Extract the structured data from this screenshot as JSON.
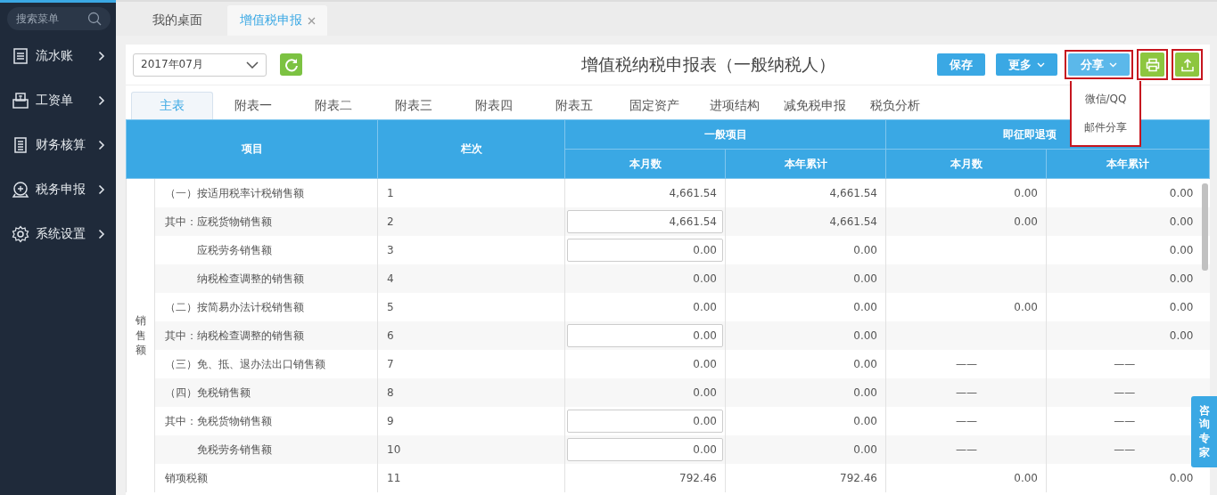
{
  "sidebar": {
    "search": {
      "placeholder": "搜索菜单"
    },
    "items": [
      {
        "label": "流水账"
      },
      {
        "label": "工资单"
      },
      {
        "label": "财务核算"
      },
      {
        "label": "税务申报"
      },
      {
        "label": "系统设置"
      }
    ]
  },
  "page_tabs": [
    {
      "label": "我的桌面",
      "selected": false,
      "closable": false
    },
    {
      "label": "增值税申报",
      "selected": true,
      "closable": true
    }
  ],
  "toolbar": {
    "period": "2017年07月",
    "title": "增值税纳税申报表（一般纳税人）",
    "buttons": [
      {
        "label": "保存",
        "kind": "plain",
        "highlighted": false
      },
      {
        "label": "更多",
        "kind": "menu",
        "highlighted": false
      },
      {
        "label": "分享",
        "kind": "menu",
        "highlighted": true
      }
    ],
    "icon_buttons": [
      {
        "kind": "print",
        "highlighted": true
      },
      {
        "kind": "export",
        "highlighted": true
      }
    ],
    "share_menu": [
      "微信/QQ",
      "邮件分享"
    ]
  },
  "sheet_tabs": [
    {
      "label": "主表",
      "selected": true
    },
    {
      "label": "附表一",
      "selected": false
    },
    {
      "label": "附表二",
      "selected": false
    },
    {
      "label": "附表三",
      "selected": false
    },
    {
      "label": "附表四",
      "selected": false
    },
    {
      "label": "附表五",
      "selected": false
    },
    {
      "label": "固定资产",
      "selected": false
    },
    {
      "label": "进项结构",
      "selected": false
    },
    {
      "label": "减免税申报",
      "selected": false
    },
    {
      "label": "税负分析",
      "selected": false
    }
  ],
  "table": {
    "col_item": "项目",
    "col_line": "栏次",
    "groups": [
      "一般项目",
      "即征即退项"
    ],
    "subcols": [
      "本月数",
      "本年累计",
      "本月数",
      "本年累计"
    ],
    "row_group": "销售额",
    "rows": [
      {
        "item": "（一）按适用税率计税销售额",
        "indented": false,
        "line": "1",
        "cells": [
          {
            "value": "4,661.54",
            "editable": false
          },
          {
            "value": "4,661.54",
            "editable": false
          },
          {
            "value": "0.00",
            "editable": false
          },
          {
            "value": "0.00",
            "editable": false
          }
        ]
      },
      {
        "item": "其中：应税货物销售额",
        "indented": false,
        "line": "2",
        "cells": [
          {
            "value": "4,661.54",
            "editable": true
          },
          {
            "value": "4,661.54",
            "editable": false
          },
          {
            "value": "0.00",
            "editable": false
          },
          {
            "value": "0.00",
            "editable": false
          }
        ]
      },
      {
        "item": "应税劳务销售额",
        "indented": true,
        "line": "3",
        "cells": [
          {
            "value": "0.00",
            "editable": true
          },
          {
            "value": "0.00",
            "editable": false
          },
          null,
          {
            "value": "0.00",
            "editable": false
          }
        ]
      },
      {
        "item": "纳税检查调整的销售额",
        "indented": true,
        "line": "4",
        "cells": [
          {
            "value": "0.00",
            "editable": false
          },
          {
            "value": "0.00",
            "editable": false
          },
          null,
          {
            "value": "0.00",
            "editable": false
          }
        ]
      },
      {
        "item": "（二）按简易办法计税销售额",
        "indented": false,
        "line": "5",
        "cells": [
          {
            "value": "0.00",
            "editable": false
          },
          {
            "value": "0.00",
            "editable": false
          },
          {
            "value": "0.00",
            "editable": false
          },
          {
            "value": "0.00",
            "editable": false
          }
        ]
      },
      {
        "item": "其中：纳税检查调整的销售额",
        "indented": false,
        "line": "6",
        "cells": [
          {
            "value": "0.00",
            "editable": true
          },
          {
            "value": "0.00",
            "editable": false
          },
          null,
          {
            "value": "0.00",
            "editable": false
          }
        ]
      },
      {
        "item": "（三）免、抵、退办法出口销售额",
        "indented": false,
        "line": "7",
        "cells": [
          {
            "value": "0.00",
            "editable": false
          },
          {
            "value": "0.00",
            "editable": false
          },
          {
            "value": "——",
            "editable": false,
            "dash": true
          },
          {
            "value": "——",
            "editable": false,
            "dash": true
          }
        ]
      },
      {
        "item": "（四）免税销售额",
        "indented": false,
        "line": "8",
        "cells": [
          {
            "value": "0.00",
            "editable": false
          },
          {
            "value": "0.00",
            "editable": false
          },
          {
            "value": "——",
            "editable": false,
            "dash": true
          },
          {
            "value": "——",
            "editable": false,
            "dash": true
          }
        ]
      },
      {
        "item": "其中：免税货物销售额",
        "indented": false,
        "line": "9",
        "cells": [
          {
            "value": "0.00",
            "editable": true
          },
          {
            "value": "0.00",
            "editable": false
          },
          {
            "value": "——",
            "editable": false,
            "dash": true
          },
          {
            "value": "——",
            "editable": false,
            "dash": true
          }
        ]
      },
      {
        "item": "免税劳务销售额",
        "indented": true,
        "line": "10",
        "cells": [
          {
            "value": "0.00",
            "editable": true
          },
          {
            "value": "0.00",
            "editable": false
          },
          {
            "value": "——",
            "editable": false,
            "dash": true
          },
          {
            "value": "——",
            "editable": false,
            "dash": true
          }
        ]
      },
      {
        "item": "销项税额",
        "indented": false,
        "line": "11",
        "cells": [
          {
            "value": "792.46",
            "editable": false
          },
          {
            "value": "792.46",
            "editable": false
          },
          {
            "value": "0.00",
            "editable": false
          },
          {
            "value": "0.00",
            "editable": false
          }
        ]
      }
    ]
  },
  "consult_button": "咨询专家"
}
